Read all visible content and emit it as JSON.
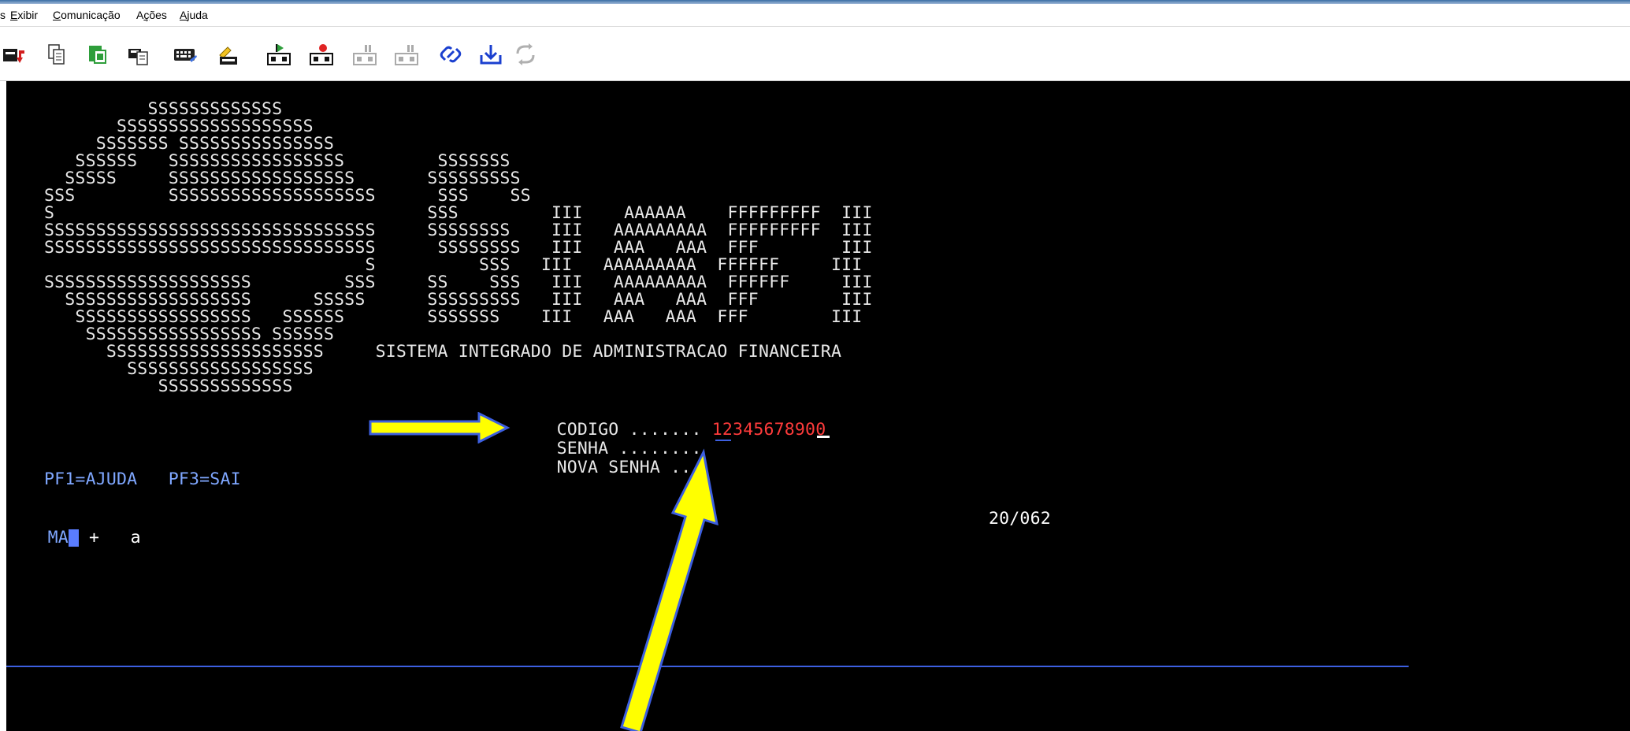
{
  "menu": {
    "partial_left": "s",
    "items": [
      "Exibir",
      "Comunicação",
      "Ações",
      "Ajuda"
    ]
  },
  "toolbar": {
    "icons": [
      "receive-icon",
      "copy-icon",
      "paste-icon",
      "clipboard-icon",
      "keyboard-icon",
      "macro-icon",
      "play-macro-icon",
      "record-macro-icon",
      "pause-macro-icon",
      "stop-macro-icon",
      "link-icon",
      "download-icon",
      "refresh-icon"
    ]
  },
  "terminal": {
    "logo_lines": [
      "          SSSSSSSSSSSSS",
      "       SSSSSSSSSSSSSSSSSSS",
      "     SSSSSSS SSSSSSSSSSSSSSS",
      "   SSSSSS   SSSSSSSSSSSSSSSSS         SSSSSSS",
      "  SSSSS     SSSSSSSSSSSSSSSSSS       SSSSSSSSS",
      "SSS         SSSSSSSSSSSSSSSSSSSS      SSS    SS",
      "S                                    SSS         III    AAAAAA    FFFFFFFFF  III",
      "SSSSSSSSSSSSSSSSSSSSSSSSSSSSSSSS     SSSSSSSS    III   AAAAAAAAA  FFFFFFFFF  III",
      "SSSSSSSSSSSSSSSSSSSSSSSSSSSSSSSS      SSSSSSSS   III   AAA   AAA  FFF        III",
      "                               S          SSS   III   AAAAAAAAA  FFFFFF     III",
      "SSSSSSSSSSSSSSSSSSSS         SSS     SS    SSS   III   AAAAAAAAA  FFFFFF     III",
      "  SSSSSSSSSSSSSSSSSS      SSSSS      SSSSSSSSS   III   AAA   AAA  FFF        III",
      "   SSSSSSSSSSSSSSSSS   SSSSSS        SSSSSSS    III   AAA   AAA  FFF        III",
      "    SSSSSSSSSSSSSSSSS SSSSSS",
      "      SSSSSSSSSSSSSSSSSSSSS     SISTEMA INTEGRADO DE ADMINISTRACAO FINANCEIRA",
      "        SSSSSSSSSSSSSSSSSS",
      "           SSSSSSSSSSSSS"
    ],
    "codigo_label": "CODIGO .......",
    "codigo_value": "12345678900",
    "senha_label": "SENHA ........",
    "nova_senha_label": "NOVA SENHA ...",
    "function_keys": "PF1=AJUDA   PF3=SAI",
    "status_left": "MA",
    "status_plus": "+",
    "status_a": "a",
    "cursor_position": "20/062"
  },
  "colors": {
    "screen_bg": "#000000",
    "text": "#e8e8e8",
    "pf_keys": "#7fa7ff",
    "codigo_value": "#ff3b3b",
    "arrow": "#ffff00",
    "status_line": "#3d5fe0"
  }
}
